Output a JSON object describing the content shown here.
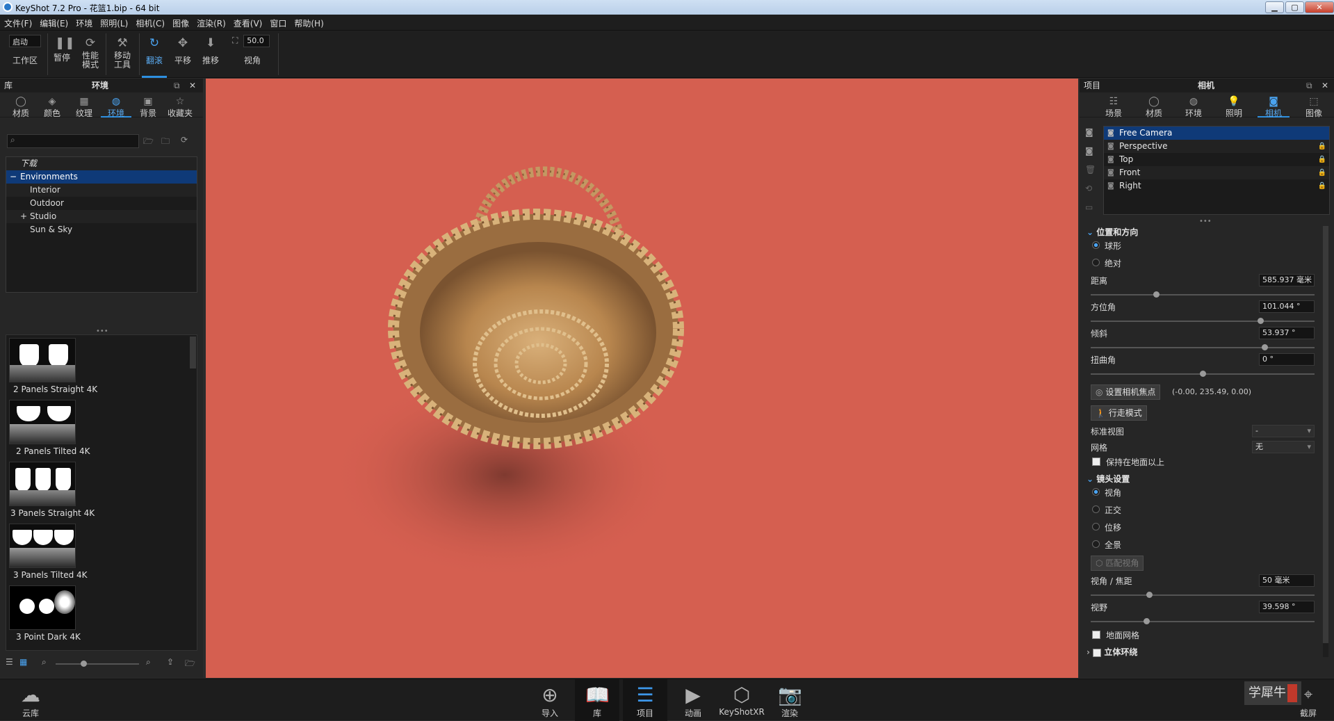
{
  "titlebar": {
    "title": "KeyShot 7.2 Pro  - 花篮1.bip  - 64 bit",
    "min": "▁",
    "max": "▢",
    "close": "✕"
  },
  "menu": [
    "文件(F)",
    "编辑(E)",
    "环境",
    "照明(L)",
    "相机(C)",
    "图像",
    "渲染(R)",
    "查看(V)",
    "窗口",
    "帮助(H)"
  ],
  "toolbar": {
    "workspace_value": "启动",
    "workspace_label": "工作区",
    "pause": "暂停",
    "perf_mode": "性能\n模式",
    "move_tool": "移动\n工具",
    "tumble": "翻滚",
    "pan": "平移",
    "dolly": "推移",
    "fov_value": "50.0",
    "fov_label": "视角"
  },
  "library": {
    "title": "库",
    "panel_title": "环境",
    "tabs": [
      "材质",
      "颜色",
      "纹理",
      "环境",
      "背景",
      "收藏夹"
    ],
    "tree": [
      "下载",
      "Environments",
      "Interior",
      "Outdoor",
      "Studio",
      "Sun & Sky"
    ],
    "thumbs": [
      "2 Panels Straight 4K",
      "2 Panels Tilted 4K",
      "3 Panels Straight 4K",
      "3 Panels Tilted 4K",
      "3 Point Dark 4K"
    ]
  },
  "project": {
    "title": "项目",
    "panel_title": "相机",
    "tabs": [
      "场景",
      "材质",
      "环境",
      "照明",
      "相机",
      "图像"
    ],
    "cameras": [
      "Free Camera",
      "Perspective",
      "Top",
      "Front",
      "Right"
    ],
    "pos_section": "位置和方向",
    "mode_sphere": "球形",
    "mode_absolute": "绝对",
    "distance_label": "距离",
    "distance_value": "585.937 毫米",
    "azimuth_label": "方位角",
    "azimuth_value": "101.044 °",
    "incline_label": "倾斜",
    "incline_value": "53.937 °",
    "twist_label": "扭曲角",
    "twist_value": "0 °",
    "set_focus_btn": "设置相机焦点",
    "focus_coords": "(-0.00, 235.49, 0.00)",
    "walk_btn": "行走模式",
    "std_view_label": "标准视图",
    "std_view_value": "-",
    "grid_label": "网格",
    "grid_value": "无",
    "keep_above": "保持在地面以上",
    "lens_section": "镜头设置",
    "lens_perspective": "视角",
    "lens_ortho": "正交",
    "lens_shift": "位移",
    "lens_panorama": "全景",
    "match_btn": "匹配视角",
    "focal_label": "视角 / 焦距",
    "focal_value": "50 毫米",
    "fov_label": "视野",
    "fov_value": "39.598 °",
    "ground_grid": "地面网格",
    "stereo_section": "立体环绕"
  },
  "bottom": {
    "cloud": "云库",
    "import": "导入",
    "library": "库",
    "project": "项目",
    "animation": "动画",
    "keyshotxr": "KeyShotXR",
    "render": "渲染",
    "screenshot": "截屏"
  },
  "watermark": "学犀牛",
  "colors": {
    "viewport_bg": "#d55f50",
    "accent": "#2d8fe0",
    "selection": "#0f3a78"
  }
}
